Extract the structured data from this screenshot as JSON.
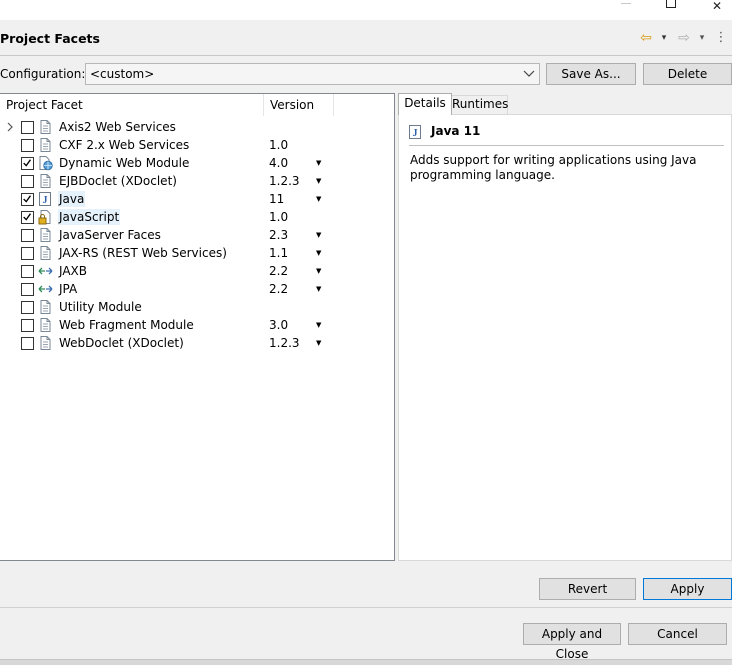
{
  "window": {
    "minimize_glyph": "",
    "maximize_glyph": "",
    "close_glyph": "✕"
  },
  "header": {
    "title": "Project Facets",
    "icons": [
      "back-arrow-icon",
      "dropdown-icon",
      "forward-arrow-icon",
      "dropdown-icon",
      "more-icon"
    ],
    "back_glyph": "⇦",
    "forward_glyph": "⇨",
    "dropdown_glyph": "▾",
    "more_glyph": "⋮"
  },
  "configuration": {
    "label": "Configuration:",
    "value": "<custom>",
    "save_as_label": "Save As...",
    "delete_label": "Delete"
  },
  "facets": {
    "columns": [
      "Project Facet",
      "Version"
    ],
    "rows": [
      {
        "name": "Axis2 Web Services",
        "version": "",
        "checked": false,
        "expandable": true,
        "dropdown": false,
        "icon": "document-icon"
      },
      {
        "name": "CXF 2.x Web Services",
        "version": "1.0",
        "checked": false,
        "expandable": false,
        "dropdown": false,
        "icon": "document-icon"
      },
      {
        "name": "Dynamic Web Module",
        "version": "4.0",
        "checked": true,
        "expandable": false,
        "dropdown": true,
        "icon": "web-module-icon"
      },
      {
        "name": "EJBDoclet (XDoclet)",
        "version": "1.2.3",
        "checked": false,
        "expandable": false,
        "dropdown": true,
        "icon": "document-icon"
      },
      {
        "name": "Java",
        "version": "11",
        "checked": true,
        "expandable": false,
        "dropdown": true,
        "icon": "java-icon",
        "selected": true
      },
      {
        "name": "JavaScript",
        "version": "1.0",
        "checked": true,
        "expandable": false,
        "dropdown": false,
        "icon": "javascript-lock-icon",
        "selected": true
      },
      {
        "name": "JavaServer Faces",
        "version": "2.3",
        "checked": false,
        "expandable": false,
        "dropdown": true,
        "icon": "document-icon"
      },
      {
        "name": "JAX-RS (REST Web Services)",
        "version": "1.1",
        "checked": false,
        "expandable": false,
        "dropdown": true,
        "icon": "document-icon"
      },
      {
        "name": "JAXB",
        "version": "2.2",
        "checked": false,
        "expandable": false,
        "dropdown": true,
        "icon": "exchange-arrows-icon"
      },
      {
        "name": "JPA",
        "version": "2.2",
        "checked": false,
        "expandable": false,
        "dropdown": true,
        "icon": "exchange-arrows-icon"
      },
      {
        "name": "Utility Module",
        "version": "",
        "checked": false,
        "expandable": false,
        "dropdown": false,
        "icon": "document-icon"
      },
      {
        "name": "Web Fragment Module",
        "version": "3.0",
        "checked": false,
        "expandable": false,
        "dropdown": true,
        "icon": "document-icon"
      },
      {
        "name": "WebDoclet (XDoclet)",
        "version": "1.2.3",
        "checked": false,
        "expandable": false,
        "dropdown": true,
        "icon": "document-icon"
      }
    ],
    "dropdown_glyph": "▼"
  },
  "details": {
    "tabs": [
      "Details",
      "Runtimes"
    ],
    "active_tab": "Details",
    "title": "Java 11",
    "description": "Adds support for writing applications using Java programming language."
  },
  "buttons": {
    "revert": "Revert",
    "apply": "Apply",
    "apply_and_close": "Apply and Close",
    "cancel": "Cancel"
  },
  "colors": {
    "selection": "#e5f1fb",
    "accent_border": "#0078d7",
    "back_arrow": "#d79a12"
  }
}
